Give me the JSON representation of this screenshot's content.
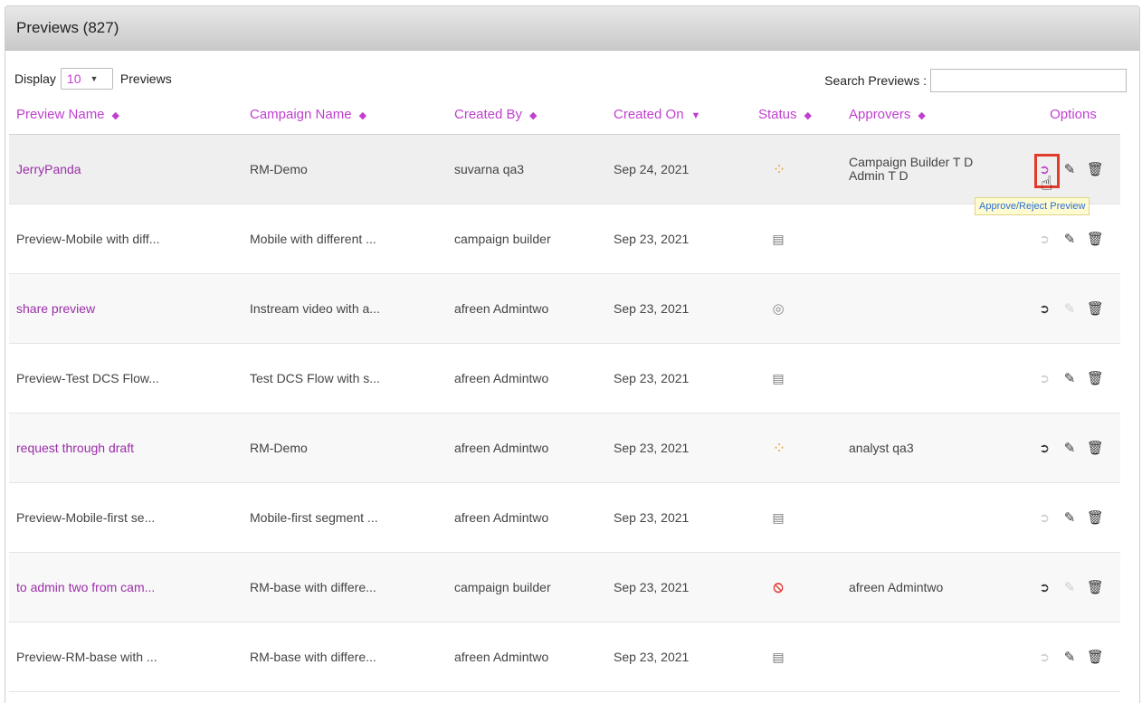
{
  "panel": {
    "title": "Previews (827)"
  },
  "toolbar": {
    "display_label": "Display",
    "page_size": "10",
    "previews_label": "Previews",
    "search_label": "Search Previews :",
    "search_value": ""
  },
  "columns": {
    "preview_name": "Preview Name",
    "campaign_name": "Campaign Name",
    "created_by": "Created By",
    "created_on": "Created On",
    "status": "Status",
    "approvers": "Approvers",
    "options": "Options"
  },
  "rows": [
    {
      "preview_name": "JerryPanda",
      "campaign_name": "RM-Demo",
      "created_by": "suvarna qa3",
      "created_on": "Sep 24, 2021",
      "status_icon": "spinner-icon",
      "approvers_line1": "Campaign Builder T D",
      "approvers_line2": "Admin T D",
      "link": true,
      "submit_enabled": true,
      "edit_enabled": true
    },
    {
      "preview_name": "Preview-Mobile with diff...",
      "campaign_name": "Mobile with different ...",
      "created_by": "campaign builder",
      "created_on": "Sep 23, 2021",
      "status_icon": "document-icon",
      "approvers_line1": "",
      "approvers_line2": "",
      "link": false,
      "submit_enabled": false,
      "edit_enabled": true
    },
    {
      "preview_name": "share preview",
      "campaign_name": "Instream video with a...",
      "created_by": "afreen Admintwo",
      "created_on": "Sep 23, 2021",
      "status_icon": "eye-icon",
      "approvers_line1": "",
      "approvers_line2": "",
      "link": true,
      "submit_enabled": true,
      "edit_enabled": false
    },
    {
      "preview_name": "Preview-Test DCS Flow...",
      "campaign_name": "Test DCS Flow with s...",
      "created_by": "afreen Admintwo",
      "created_on": "Sep 23, 2021",
      "status_icon": "document-icon",
      "approvers_line1": "",
      "approvers_line2": "",
      "link": false,
      "submit_enabled": false,
      "edit_enabled": true
    },
    {
      "preview_name": "request through draft",
      "campaign_name": "RM-Demo",
      "created_by": "afreen Admintwo",
      "created_on": "Sep 23, 2021",
      "status_icon": "spinner-icon",
      "approvers_line1": "analyst qa3",
      "approvers_line2": "",
      "link": true,
      "submit_enabled": true,
      "edit_enabled": true
    },
    {
      "preview_name": "Preview-Mobile-first se...",
      "campaign_name": "Mobile-first segment ...",
      "created_by": "afreen Admintwo",
      "created_on": "Sep 23, 2021",
      "status_icon": "document-icon",
      "approvers_line1": "",
      "approvers_line2": "",
      "link": false,
      "submit_enabled": false,
      "edit_enabled": true
    },
    {
      "preview_name": "to admin two from cam...",
      "campaign_name": "RM-base with differe...",
      "created_by": "campaign builder",
      "created_on": "Sep 23, 2021",
      "status_icon": "ban-icon",
      "approvers_line1": "afreen Admintwo",
      "approvers_line2": "",
      "link": true,
      "submit_enabled": true,
      "edit_enabled": false
    },
    {
      "preview_name": "Preview-RM-base with ...",
      "campaign_name": "RM-base with differe...",
      "created_by": "afreen Admintwo",
      "created_on": "Sep 23, 2021",
      "status_icon": "document-icon",
      "approvers_line1": "",
      "approvers_line2": "",
      "link": false,
      "submit_enabled": false,
      "edit_enabled": true
    }
  ],
  "tooltip": {
    "text": "Approve/Reject Preview"
  },
  "colors": {
    "accent": "#c13fd0",
    "link": "#9a2ea8",
    "highlight": "#e23a2b",
    "spinner": "#f5a23a",
    "reject": "#e0443d"
  }
}
